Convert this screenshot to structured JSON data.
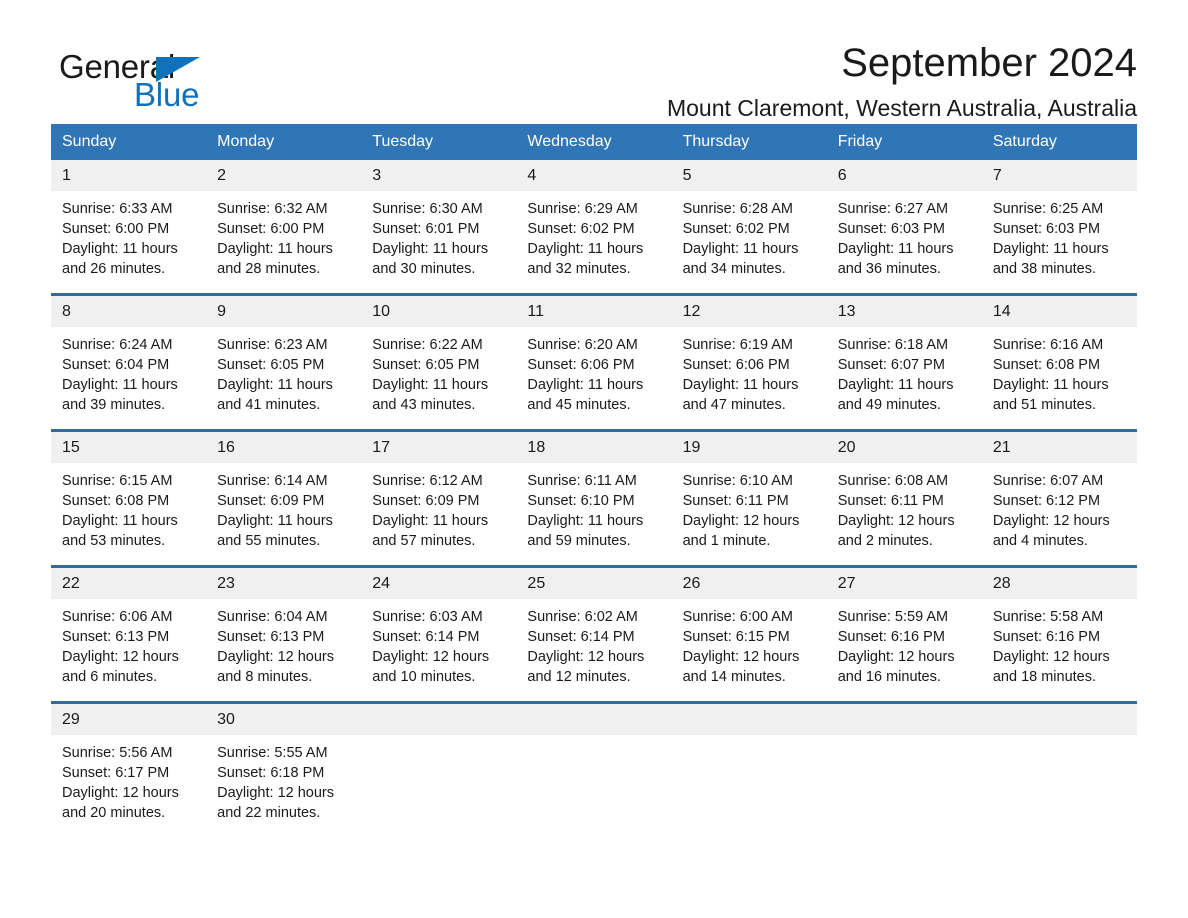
{
  "brand": {
    "name_part1": "General",
    "name_part2": "Blue",
    "triangle_color": "#1072ba",
    "blue_color": "#1072ba"
  },
  "header": {
    "title": "September 2024",
    "subtitle": "Mount Claremont, Western Australia, Australia"
  },
  "theme": {
    "header_blue": "#3075b5",
    "rule_blue": "#2e6da4",
    "date_band": "#f0f0f0",
    "text": "#1a1a1a"
  },
  "weekdays": [
    "Sunday",
    "Monday",
    "Tuesday",
    "Wednesday",
    "Thursday",
    "Friday",
    "Saturday"
  ],
  "weeks": [
    [
      {
        "date": "1",
        "sunrise": "Sunrise: 6:33 AM",
        "sunset": "Sunset: 6:00 PM",
        "daylight1": "Daylight: 11 hours",
        "daylight2": "and 26 minutes."
      },
      {
        "date": "2",
        "sunrise": "Sunrise: 6:32 AM",
        "sunset": "Sunset: 6:00 PM",
        "daylight1": "Daylight: 11 hours",
        "daylight2": "and 28 minutes."
      },
      {
        "date": "3",
        "sunrise": "Sunrise: 6:30 AM",
        "sunset": "Sunset: 6:01 PM",
        "daylight1": "Daylight: 11 hours",
        "daylight2": "and 30 minutes."
      },
      {
        "date": "4",
        "sunrise": "Sunrise: 6:29 AM",
        "sunset": "Sunset: 6:02 PM",
        "daylight1": "Daylight: 11 hours",
        "daylight2": "and 32 minutes."
      },
      {
        "date": "5",
        "sunrise": "Sunrise: 6:28 AM",
        "sunset": "Sunset: 6:02 PM",
        "daylight1": "Daylight: 11 hours",
        "daylight2": "and 34 minutes."
      },
      {
        "date": "6",
        "sunrise": "Sunrise: 6:27 AM",
        "sunset": "Sunset: 6:03 PM",
        "daylight1": "Daylight: 11 hours",
        "daylight2": "and 36 minutes."
      },
      {
        "date": "7",
        "sunrise": "Sunrise: 6:25 AM",
        "sunset": "Sunset: 6:03 PM",
        "daylight1": "Daylight: 11 hours",
        "daylight2": "and 38 minutes."
      }
    ],
    [
      {
        "date": "8",
        "sunrise": "Sunrise: 6:24 AM",
        "sunset": "Sunset: 6:04 PM",
        "daylight1": "Daylight: 11 hours",
        "daylight2": "and 39 minutes."
      },
      {
        "date": "9",
        "sunrise": "Sunrise: 6:23 AM",
        "sunset": "Sunset: 6:05 PM",
        "daylight1": "Daylight: 11 hours",
        "daylight2": "and 41 minutes."
      },
      {
        "date": "10",
        "sunrise": "Sunrise: 6:22 AM",
        "sunset": "Sunset: 6:05 PM",
        "daylight1": "Daylight: 11 hours",
        "daylight2": "and 43 minutes."
      },
      {
        "date": "11",
        "sunrise": "Sunrise: 6:20 AM",
        "sunset": "Sunset: 6:06 PM",
        "daylight1": "Daylight: 11 hours",
        "daylight2": "and 45 minutes."
      },
      {
        "date": "12",
        "sunrise": "Sunrise: 6:19 AM",
        "sunset": "Sunset: 6:06 PM",
        "daylight1": "Daylight: 11 hours",
        "daylight2": "and 47 minutes."
      },
      {
        "date": "13",
        "sunrise": "Sunrise: 6:18 AM",
        "sunset": "Sunset: 6:07 PM",
        "daylight1": "Daylight: 11 hours",
        "daylight2": "and 49 minutes."
      },
      {
        "date": "14",
        "sunrise": "Sunrise: 6:16 AM",
        "sunset": "Sunset: 6:08 PM",
        "daylight1": "Daylight: 11 hours",
        "daylight2": "and 51 minutes."
      }
    ],
    [
      {
        "date": "15",
        "sunrise": "Sunrise: 6:15 AM",
        "sunset": "Sunset: 6:08 PM",
        "daylight1": "Daylight: 11 hours",
        "daylight2": "and 53 minutes."
      },
      {
        "date": "16",
        "sunrise": "Sunrise: 6:14 AM",
        "sunset": "Sunset: 6:09 PM",
        "daylight1": "Daylight: 11 hours",
        "daylight2": "and 55 minutes."
      },
      {
        "date": "17",
        "sunrise": "Sunrise: 6:12 AM",
        "sunset": "Sunset: 6:09 PM",
        "daylight1": "Daylight: 11 hours",
        "daylight2": "and 57 minutes."
      },
      {
        "date": "18",
        "sunrise": "Sunrise: 6:11 AM",
        "sunset": "Sunset: 6:10 PM",
        "daylight1": "Daylight: 11 hours",
        "daylight2": "and 59 minutes."
      },
      {
        "date": "19",
        "sunrise": "Sunrise: 6:10 AM",
        "sunset": "Sunset: 6:11 PM",
        "daylight1": "Daylight: 12 hours",
        "daylight2": "and 1 minute."
      },
      {
        "date": "20",
        "sunrise": "Sunrise: 6:08 AM",
        "sunset": "Sunset: 6:11 PM",
        "daylight1": "Daylight: 12 hours",
        "daylight2": "and 2 minutes."
      },
      {
        "date": "21",
        "sunrise": "Sunrise: 6:07 AM",
        "sunset": "Sunset: 6:12 PM",
        "daylight1": "Daylight: 12 hours",
        "daylight2": "and 4 minutes."
      }
    ],
    [
      {
        "date": "22",
        "sunrise": "Sunrise: 6:06 AM",
        "sunset": "Sunset: 6:13 PM",
        "daylight1": "Daylight: 12 hours",
        "daylight2": "and 6 minutes."
      },
      {
        "date": "23",
        "sunrise": "Sunrise: 6:04 AM",
        "sunset": "Sunset: 6:13 PM",
        "daylight1": "Daylight: 12 hours",
        "daylight2": "and 8 minutes."
      },
      {
        "date": "24",
        "sunrise": "Sunrise: 6:03 AM",
        "sunset": "Sunset: 6:14 PM",
        "daylight1": "Daylight: 12 hours",
        "daylight2": "and 10 minutes."
      },
      {
        "date": "25",
        "sunrise": "Sunrise: 6:02 AM",
        "sunset": "Sunset: 6:14 PM",
        "daylight1": "Daylight: 12 hours",
        "daylight2": "and 12 minutes."
      },
      {
        "date": "26",
        "sunrise": "Sunrise: 6:00 AM",
        "sunset": "Sunset: 6:15 PM",
        "daylight1": "Daylight: 12 hours",
        "daylight2": "and 14 minutes."
      },
      {
        "date": "27",
        "sunrise": "Sunrise: 5:59 AM",
        "sunset": "Sunset: 6:16 PM",
        "daylight1": "Daylight: 12 hours",
        "daylight2": "and 16 minutes."
      },
      {
        "date": "28",
        "sunrise": "Sunrise: 5:58 AM",
        "sunset": "Sunset: 6:16 PM",
        "daylight1": "Daylight: 12 hours",
        "daylight2": "and 18 minutes."
      }
    ],
    [
      {
        "date": "29",
        "sunrise": "Sunrise: 5:56 AM",
        "sunset": "Sunset: 6:17 PM",
        "daylight1": "Daylight: 12 hours",
        "daylight2": "and 20 minutes."
      },
      {
        "date": "30",
        "sunrise": "Sunrise: 5:55 AM",
        "sunset": "Sunset: 6:18 PM",
        "daylight1": "Daylight: 12 hours",
        "daylight2": "and 22 minutes."
      },
      {
        "date": "",
        "sunrise": "",
        "sunset": "",
        "daylight1": "",
        "daylight2": ""
      },
      {
        "date": "",
        "sunrise": "",
        "sunset": "",
        "daylight1": "",
        "daylight2": ""
      },
      {
        "date": "",
        "sunrise": "",
        "sunset": "",
        "daylight1": "",
        "daylight2": ""
      },
      {
        "date": "",
        "sunrise": "",
        "sunset": "",
        "daylight1": "",
        "daylight2": ""
      },
      {
        "date": "",
        "sunrise": "",
        "sunset": "",
        "daylight1": "",
        "daylight2": ""
      }
    ]
  ]
}
